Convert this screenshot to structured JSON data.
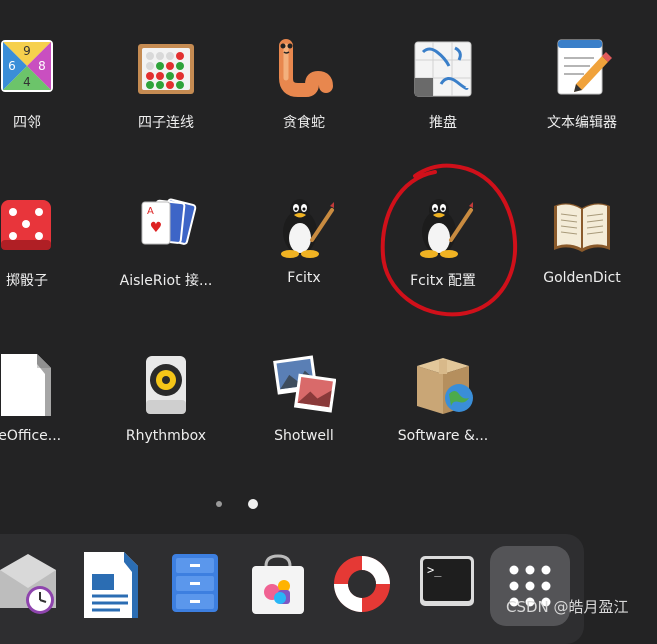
{
  "apps": [
    {
      "label": "四邻"
    },
    {
      "label": "四子连线"
    },
    {
      "label": "贪食蛇"
    },
    {
      "label": "推盘"
    },
    {
      "label": "文本编辑器"
    },
    {
      "label": "掷骰子"
    },
    {
      "label": "AisleRiot 接..."
    },
    {
      "label": "Fcitx"
    },
    {
      "label": "Fcitx 配置"
    },
    {
      "label": "GoldenDict"
    },
    {
      "label": "reOffice..."
    },
    {
      "label": "Rhythmbox"
    },
    {
      "label": "Shotwell"
    },
    {
      "label": "Software &..."
    }
  ],
  "tetravex": {
    "top": "9",
    "left": "6",
    "right": "8",
    "bottom": "4"
  },
  "pager": {
    "current_page": 2,
    "total_pages": 2
  },
  "watermark": "CSDN @皓月盈江",
  "colors": {
    "background": "#232324",
    "dock": "#2e2e30",
    "annotation": "#d0101a"
  }
}
